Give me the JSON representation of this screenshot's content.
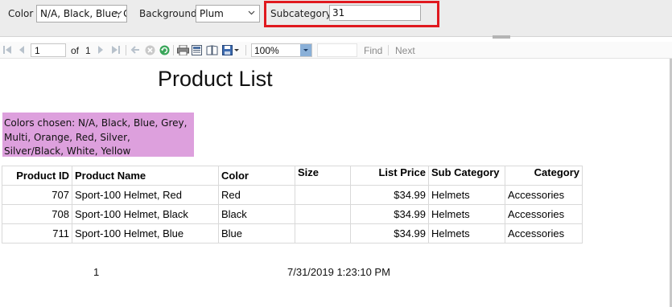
{
  "params": {
    "color_label": "Color",
    "color_value": "N/A, Black, Blue, G",
    "background_label": "Background",
    "background_value": "Plum",
    "subcategory_label": "Subcategory",
    "subcategory_value": "31"
  },
  "toolbar": {
    "page_value": "1",
    "of_label": "of",
    "total_pages": "1",
    "zoom_value": "100%",
    "find_label": "Find",
    "next_label": "Next",
    "icons": [
      "first-page-icon",
      "prev-page-icon",
      "next-page-icon",
      "last-page-icon",
      "back-icon",
      "stop-icon",
      "refresh-icon",
      "print-icon",
      "print-layout-icon",
      "page-setup-icon",
      "export-icon"
    ]
  },
  "report": {
    "title": "Product List",
    "colors_text": "Colors chosen: N/A, Black, Blue, Grey, Multi, Orange, Red, Silver, Silver/Black, White, Yellow",
    "background_color": "#dda0dd",
    "columns": [
      "Product ID",
      "Product Name",
      "Color",
      "Size",
      "List Price",
      "Sub Category",
      "Category"
    ],
    "rows": [
      {
        "id": "707",
        "name": "Sport-100 Helmet, Red",
        "color": "Red",
        "size": "",
        "price": "$34.99",
        "subcategory": "Helmets",
        "category": "Accessories"
      },
      {
        "id": "708",
        "name": "Sport-100 Helmet, Black",
        "color": "Black",
        "size": "",
        "price": "$34.99",
        "subcategory": "Helmets",
        "category": "Accessories"
      },
      {
        "id": "711",
        "name": "Sport-100 Helmet, Blue",
        "color": "Blue",
        "size": "",
        "price": "$34.99",
        "subcategory": "Helmets",
        "category": "Accessories"
      }
    ],
    "footer_page": "1",
    "footer_date": "7/31/2019 1:23:10 PM"
  },
  "accent": {
    "highlight": "#e0191f"
  }
}
